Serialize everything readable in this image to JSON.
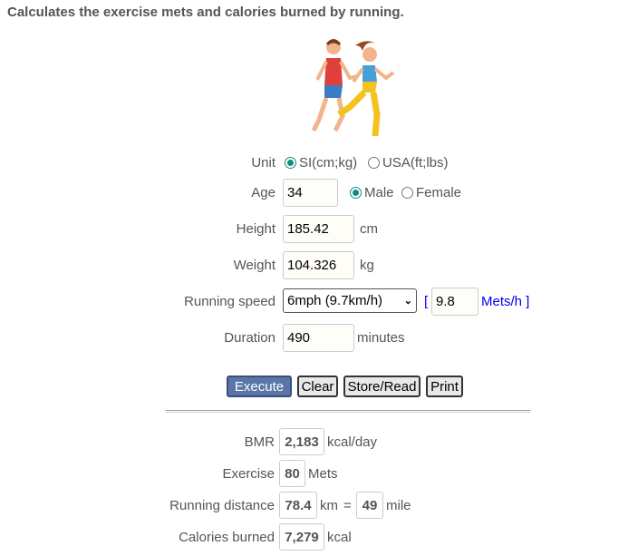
{
  "title": "Calculates the exercise mets and calories burned by running.",
  "form": {
    "unit_label": "Unit",
    "unit_si": "SI(cm;kg)",
    "unit_usa": "USA(ft;lbs)",
    "unit_selected": "SI(cm;kg)",
    "age_label": "Age",
    "age": "34",
    "male": "Male",
    "female": "Female",
    "gender_selected": "Male",
    "height_label": "Height",
    "height": "185.42",
    "height_unit": "cm",
    "weight_label": "Weight",
    "weight": "104.326",
    "weight_unit": "kg",
    "speed_label": "Running speed",
    "speed": "6mph (9.7km/h)",
    "bracket_open": "[",
    "mets": "9.8",
    "mets_unit": "Mets/h ]",
    "duration_label": "Duration",
    "duration": "490",
    "duration_unit": "minutes"
  },
  "buttons": {
    "execute": "Execute",
    "clear": "Clear",
    "store": "Store/Read",
    "print": "Print"
  },
  "results": {
    "bmr_label": "BMR",
    "bmr": "2,183",
    "bmr_unit": "kcal/day",
    "exercise_label": "Exercise",
    "exercise": "80",
    "exercise_unit": "Mets",
    "distance_label": "Running distance",
    "distance_km": "78.4",
    "km": "km",
    "equals": "=",
    "distance_mile": "49",
    "mile": "mile",
    "calories_label": "Calories burned",
    "calories": "7,279",
    "calories_unit": "kcal"
  },
  "colors": {
    "accent": "#138a86",
    "execute": "#5a75a8",
    "link": "#0000ee"
  }
}
